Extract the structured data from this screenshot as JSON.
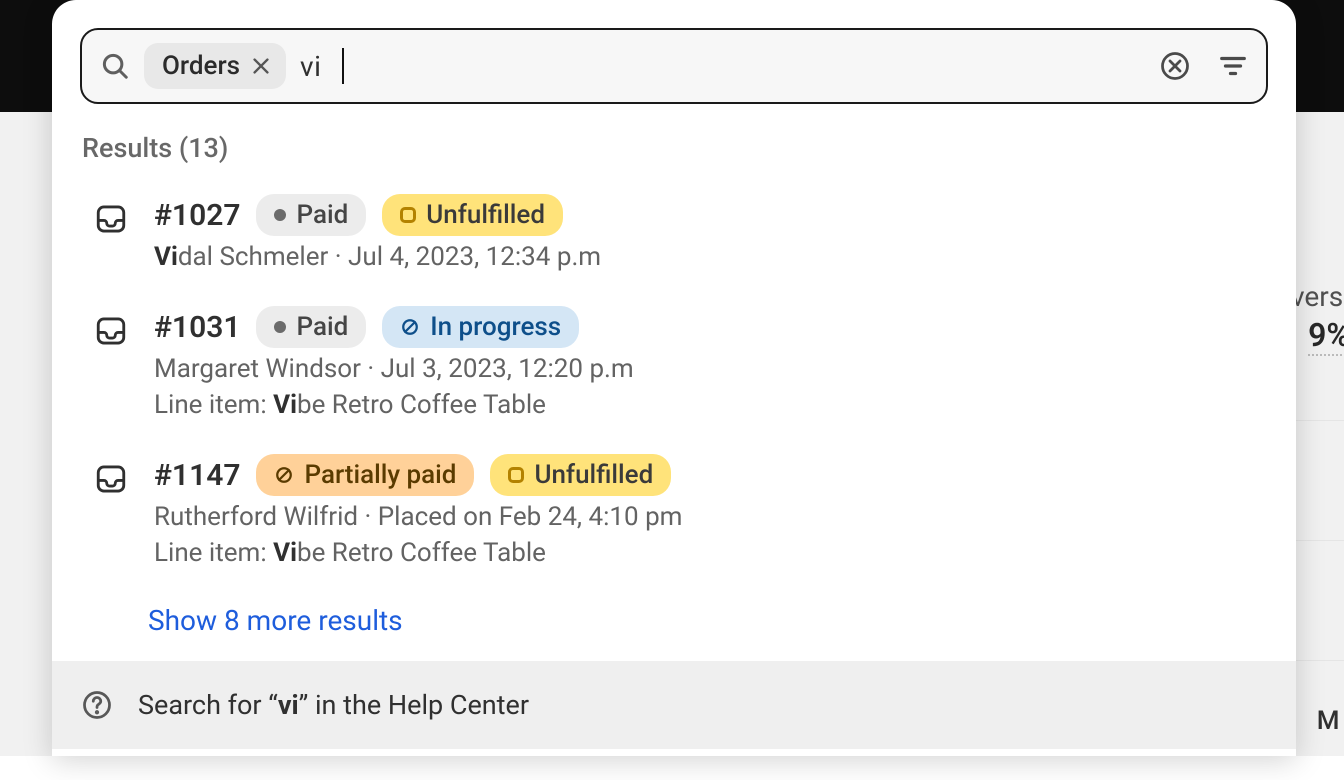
{
  "search": {
    "filter_chip": "Orders",
    "query": "vi",
    "results_label": "Results (13)"
  },
  "results": [
    {
      "id": "#1027",
      "pay_badge": {
        "kind": "gray",
        "label": "Paid",
        "icon": "dot"
      },
      "fulfill_badge": {
        "kind": "yellow",
        "label": "Unfulfilled",
        "icon": "ring"
      },
      "line1_prefix": "Vi",
      "line1_rest": "dal Schmeler · Jul 4, 2023, 12:34 p.m",
      "line2_label": "",
      "line2_prefix": "",
      "line2_rest": ""
    },
    {
      "id": "#1031",
      "pay_badge": {
        "kind": "gray",
        "label": "Paid",
        "icon": "dot"
      },
      "fulfill_badge": {
        "kind": "blue",
        "label": "In progress",
        "icon": "prohibit"
      },
      "line1_prefix": "",
      "line1_rest": "Margaret Windsor · Jul 3, 2023, 12:20 p.m",
      "line2_label": "Line item: ",
      "line2_prefix": "Vi",
      "line2_rest": "be Retro Coffee Table"
    },
    {
      "id": "#1147",
      "pay_badge": {
        "kind": "orange",
        "label": "Partially paid",
        "icon": "prohibit"
      },
      "fulfill_badge": {
        "kind": "yellow",
        "label": "Unfulfilled",
        "icon": "ring"
      },
      "line1_prefix": "",
      "line1_rest": "Rutherford Wilfrid · Placed on Feb 24, 4:10 pm",
      "line2_label": "Line item: ",
      "line2_prefix": "Vi",
      "line2_rest": "be Retro Coffee Table"
    }
  ],
  "show_more": "Show 8 more results",
  "footer": {
    "prefix": "Search for “",
    "q": "vi",
    "suffix": "” in the Help Center"
  },
  "behind": {
    "heading": "versi",
    "value": "9%",
    "rowlabel": "M"
  }
}
